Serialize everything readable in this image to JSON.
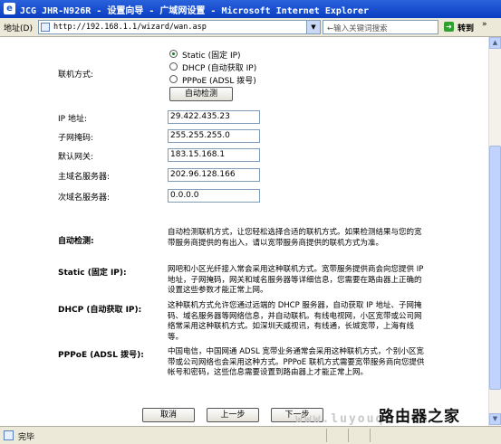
{
  "window": {
    "title": "JCG JHR-N926R - 设置向导 - 广域网设置 - Microsoft Internet Explorer"
  },
  "address_bar": {
    "label": "地址(D)",
    "url": "http://192.168.1.1/wizard/wan.asp",
    "search_placeholder": "←输入关键词搜索",
    "go_label": "转到",
    "links_label": "»"
  },
  "form": {
    "connection_label": "联机方式:",
    "radio_options": [
      {
        "label": "Static (固定 IP)",
        "selected": true
      },
      {
        "label": "DHCP (自动获取 IP)",
        "selected": false
      },
      {
        "label": "PPPoE (ADSL 拨号)",
        "selected": false
      }
    ],
    "auto_detect_button": "自动检测",
    "fields": [
      {
        "label": "IP 地址:",
        "value": "29.422.435.23"
      },
      {
        "label": "子网掩码:",
        "value": "255.255.255.0"
      },
      {
        "label": "默认网关:",
        "value": "183.15.168.1"
      },
      {
        "label": "主域名服务器:",
        "value": "202.96.128.166"
      },
      {
        "label": "次域名服务器:",
        "value": "0.0.0.0"
      }
    ]
  },
  "help": [
    {
      "title": "自动检测:",
      "text": "自动检测联机方式，让您轻松选择合适的联机方式。如果检测结果与您的宽带服务商提供的有出入，请以宽带服务商提供的联机方式为准。"
    },
    {
      "title": "Static (固定 IP):",
      "text": "网吧和小区光纤接入常会采用这种联机方式。宽带服务提供商会向您提供 IP 地址，子网掩码，网关和域名服务器等详细信息，您需要在路由器上正确的设置这些参数才能正常上网。"
    },
    {
      "title": "DHCP (自动获取 IP):",
      "text": "这种联机方式允许您通过远端的 DHCP 服务器，自动获取 IP 地址、子网掩码、域名服务器等网络信息，并自动联机。有线电视网，小区宽带或公司网络常采用这种联机方式。如深圳天威视讯，有线通，长城宽带，上海有线等。"
    },
    {
      "title": "PPPoE (ADSL 拨号):",
      "text": "中国电信，中国网通 ADSL 宽带业务通常会采用这种联机方式，个别小区宽带或公司网络也会采用这种方式。PPPoE 联机方式需要宽带服务商向您提供帐号和密码，这些信息需要设置到路由器上才能正常上网。"
    }
  ],
  "nav_buttons": {
    "cancel": "取消",
    "back": "上一步",
    "next": "下一步"
  },
  "status_bar": {
    "text": "完毕"
  },
  "watermark": {
    "brand": "路由器之家",
    "url": "www.luyouqi.com"
  }
}
